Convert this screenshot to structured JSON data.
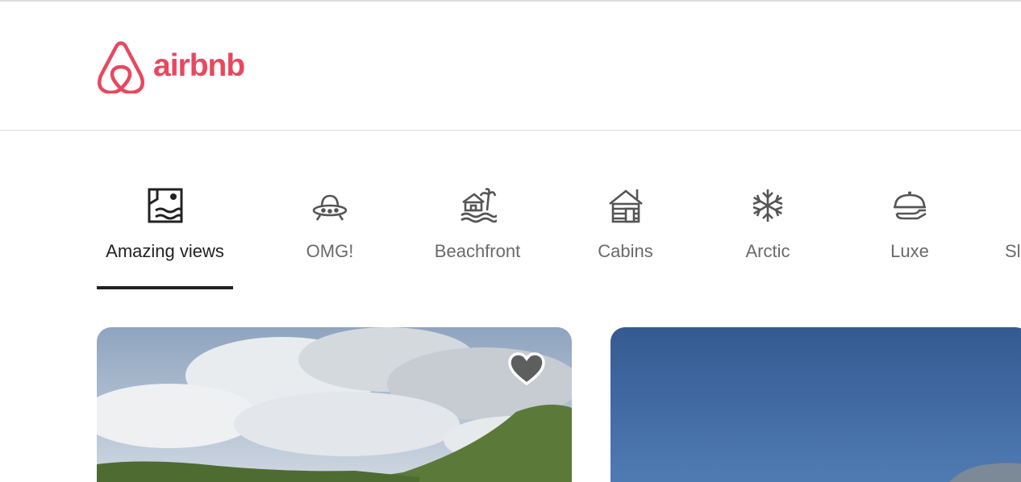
{
  "brand": {
    "name": "airbnb",
    "color": "#e8485f"
  },
  "categories": [
    {
      "label": "Amazing views",
      "icon": "amazing-views-icon",
      "active": true
    },
    {
      "label": "OMG!",
      "icon": "ufo-icon",
      "active": false
    },
    {
      "label": "Beachfront",
      "icon": "beach-house-icon",
      "active": false
    },
    {
      "label": "Cabins",
      "icon": "cabin-icon",
      "active": false
    },
    {
      "label": "Arctic",
      "icon": "snowflake-icon",
      "active": false
    },
    {
      "label": "Luxe",
      "icon": "cloche-icon",
      "active": false
    },
    {
      "label": "Sl",
      "icon": "",
      "active": false
    }
  ],
  "listings": [
    {
      "image": "cloudy-hills-photo",
      "favorite_icon": "heart-icon"
    },
    {
      "image": "blue-sky-coast-photo"
    }
  ],
  "colors": {
    "text_active": "#222222",
    "text_inactive": "#6a6a6a",
    "divider": "#dddddd"
  }
}
